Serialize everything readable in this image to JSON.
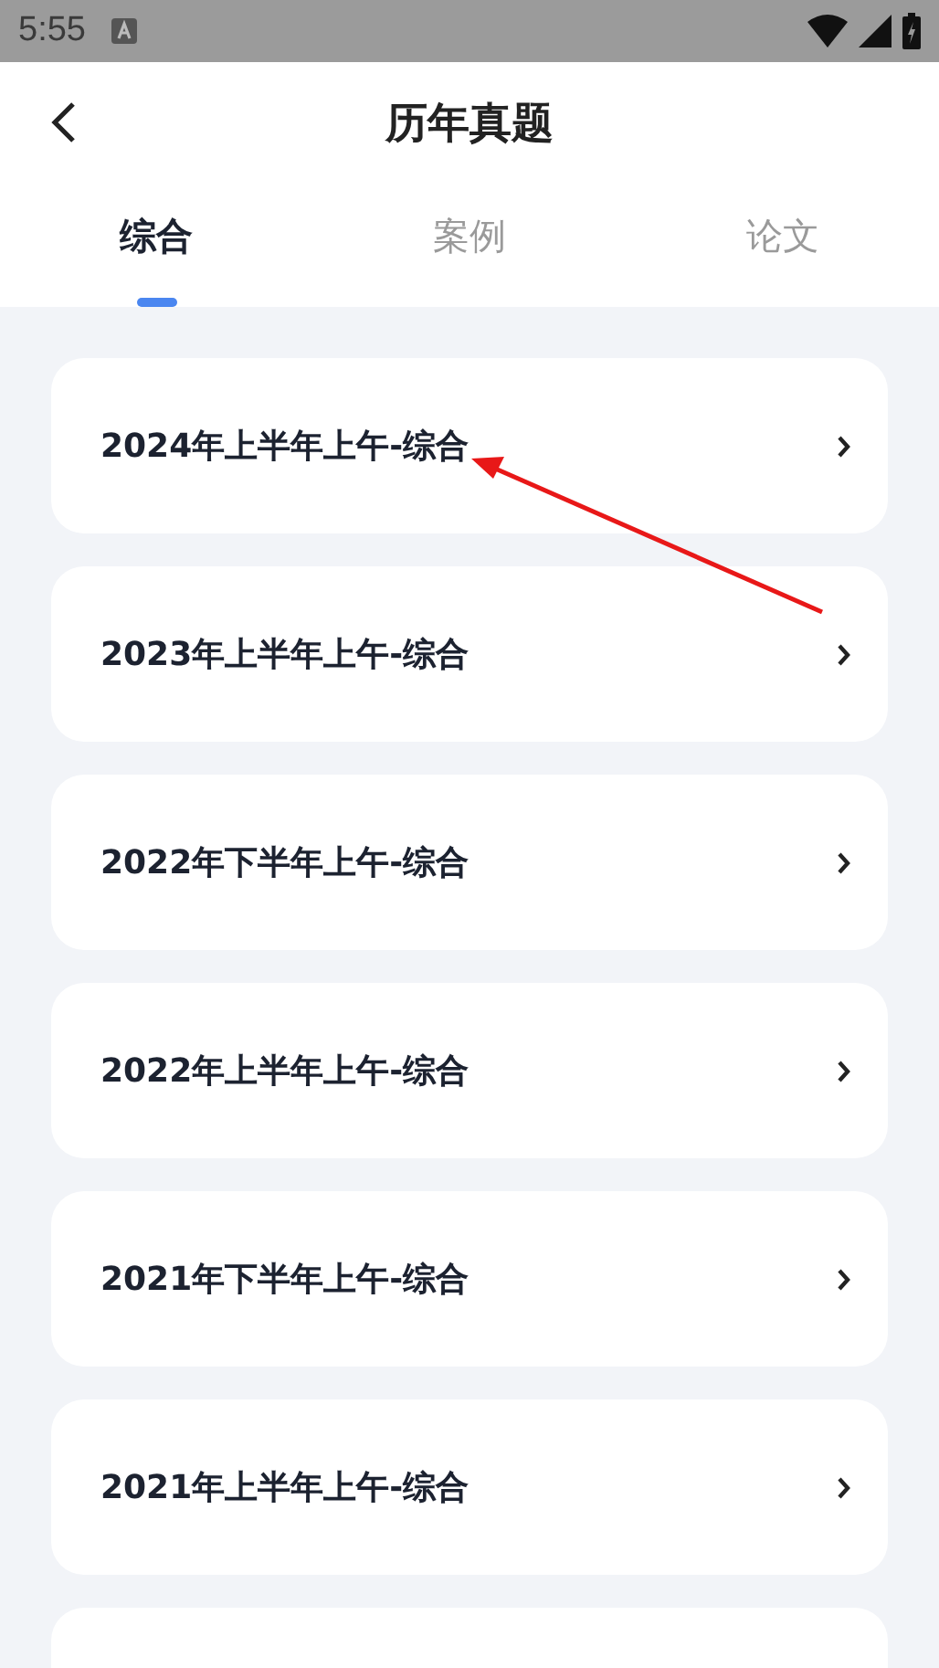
{
  "status_bar": {
    "time": "5:55"
  },
  "header": {
    "title": "历年真题"
  },
  "tabs": [
    {
      "label": "综合",
      "selected": true
    },
    {
      "label": "案例",
      "selected": false
    },
    {
      "label": "论文",
      "selected": false
    }
  ],
  "papers": [
    {
      "title": "2024年上半年上午-综合"
    },
    {
      "title": "2023年上半年上午-综合"
    },
    {
      "title": "2022年下半年上午-综合"
    },
    {
      "title": "2022年上半年上午-综合"
    },
    {
      "title": "2021年下半年上午-综合"
    },
    {
      "title": "2021年上半年上午-综合"
    }
  ]
}
